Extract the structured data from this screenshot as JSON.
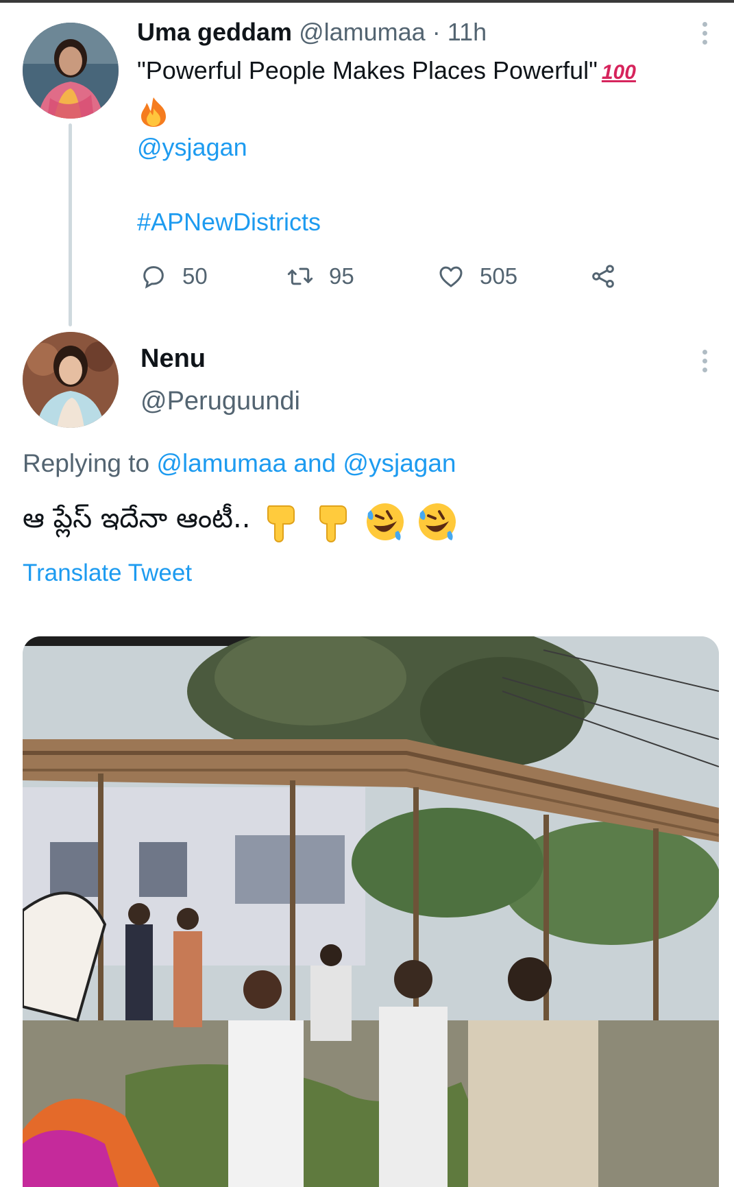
{
  "tweet": {
    "author_name": "Uma geddam",
    "author_handle": "@lamumaa",
    "separator": "·",
    "time": "11h",
    "text": "\"Powerful People Makes Places Powerful\"",
    "emoji_hundred": "100",
    "mention": "@ysjagan",
    "hashtag": "#APNewDistricts",
    "replies": "50",
    "retweets": "95",
    "likes": "505"
  },
  "reply": {
    "author_name": "Nenu",
    "author_handle": "@Peruguundi",
    "replying_prefix": "Replying to",
    "replying_mention_1": "@lamumaa",
    "replying_and": "and",
    "replying_mention_2": "@ysjagan",
    "text": "ఆ ప్లేస్ ఇదేనా ఆంటీ..",
    "translate_label": "Translate Tweet"
  },
  "icons": {
    "reply": "reply-icon",
    "retweet": "retweet-icon",
    "like": "heart-icon",
    "share": "share-icon",
    "more": "more-icon"
  },
  "colors": {
    "link": "#1d9bf0",
    "muted": "#536471",
    "text": "#0f1419",
    "hundred": "#d6245c"
  }
}
